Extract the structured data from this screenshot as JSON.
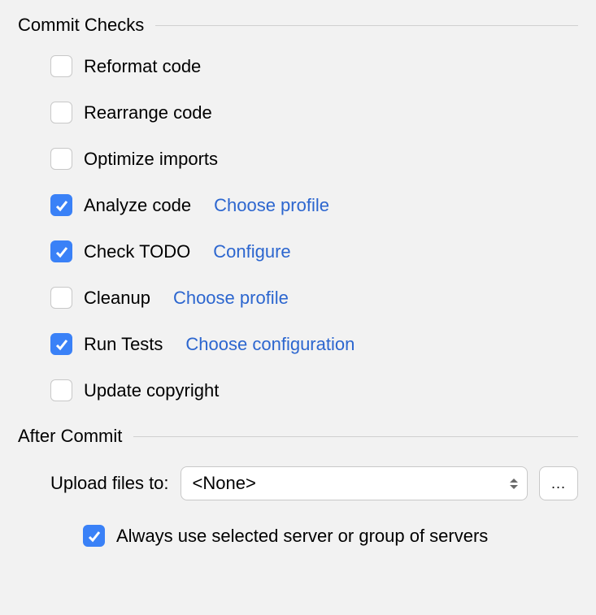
{
  "commitChecks": {
    "title": "Commit Checks",
    "items": [
      {
        "label": "Reformat code",
        "checked": false,
        "link": null
      },
      {
        "label": "Rearrange code",
        "checked": false,
        "link": null
      },
      {
        "label": "Optimize imports",
        "checked": false,
        "link": null
      },
      {
        "label": "Analyze code",
        "checked": true,
        "link": "Choose profile"
      },
      {
        "label": "Check TODO",
        "checked": true,
        "link": "Configure"
      },
      {
        "label": "Cleanup",
        "checked": false,
        "link": "Choose profile"
      },
      {
        "label": "Run Tests",
        "checked": true,
        "link": "Choose configuration"
      },
      {
        "label": "Update copyright",
        "checked": false,
        "link": null
      }
    ]
  },
  "afterCommit": {
    "title": "After Commit",
    "uploadLabel": "Upload files to:",
    "uploadValue": "<None>",
    "browseLabel": "...",
    "alwaysUse": {
      "label": "Always use selected server or group of servers",
      "checked": true
    }
  }
}
